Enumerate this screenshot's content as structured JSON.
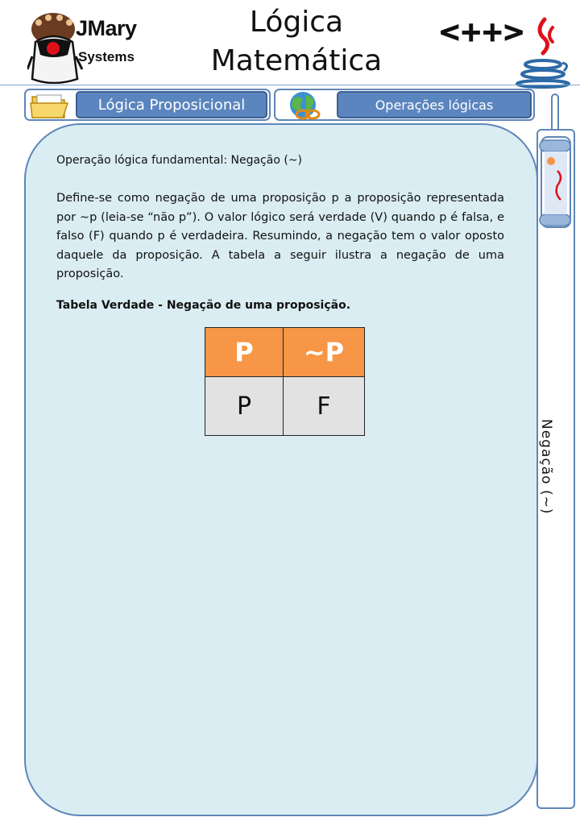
{
  "header": {
    "brand_line1": "JMary",
    "brand_line2": "Systems",
    "title": "Lógica Matemática",
    "cpp_logo_text": "<++>",
    "icons": [
      "duke-mascot-icon",
      "java-logo-icon"
    ]
  },
  "tabs": [
    {
      "label": "Lógica Proposicional",
      "icon": "folder-icon"
    },
    {
      "label": "Operações lógicas",
      "icon": "globe-icon"
    }
  ],
  "sidebar": {
    "icon": "scroll-icon",
    "label": "Negação (~)"
  },
  "content": {
    "heading": "Operação lógica fundamental: Negação (~)",
    "body": "Define-se como negação de uma proposição p a proposição representada por ~p (leia-se “não p”). O valor lógico será verdade (V) quando p é falsa, e falso (F) quando p é verdadeira. Resumindo, a negação tem o valor oposto daquele da proposição. A tabela a seguir ilustra a negação de uma proposição.",
    "table_caption": "Tabela Verdade - Negação de uma proposição.",
    "table": {
      "headers": [
        "P",
        "~P"
      ],
      "rows": [
        [
          "P",
          "F"
        ]
      ]
    }
  },
  "colors": {
    "accent_blue": "#5b85be",
    "card_background": "#daedf3",
    "table_header": "#f79646",
    "table_cell": "#e2e2e2"
  }
}
